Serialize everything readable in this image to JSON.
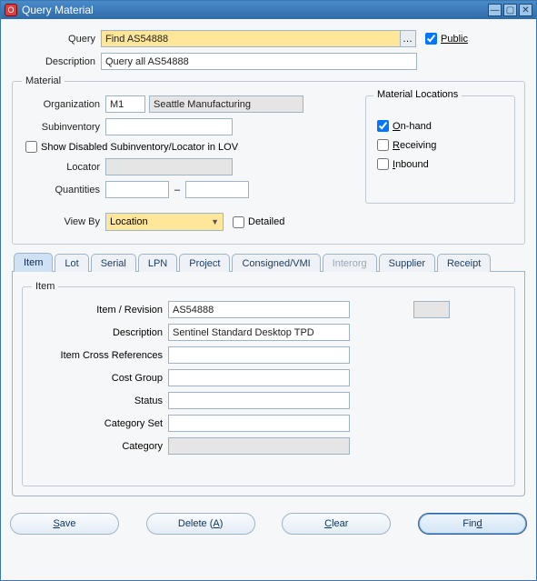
{
  "window": {
    "title": "Query Material"
  },
  "top": {
    "query_label": "Query",
    "query_value": "Find AS54888",
    "public_label": "Public",
    "public_checked": true,
    "description_label": "Description",
    "description_value": "Query all AS54888"
  },
  "material": {
    "legend": "Material",
    "organization_label": "Organization",
    "organization_code": "M1",
    "organization_name": "Seattle Manufacturing",
    "subinventory_label": "Subinventory",
    "subinventory_value": "",
    "show_disabled_label": "Show Disabled Subinventory/Locator in LOV",
    "show_disabled_checked": false,
    "locator_label": "Locator",
    "locator_value": "",
    "quantities_label": "Quantities",
    "quantity_from": "",
    "quantity_to": "",
    "locations": {
      "title": "Material Locations",
      "onhand_label": "On-hand",
      "onhand_checked": true,
      "receiving_label": "Receiving",
      "receiving_checked": false,
      "inbound_label": "Inbound",
      "inbound_checked": false
    }
  },
  "viewby": {
    "label": "View By",
    "value": "Location",
    "detailed_label": "Detailed",
    "detailed_checked": false
  },
  "tabs": {
    "names": [
      "Item",
      "Lot",
      "Serial",
      "LPN",
      "Project",
      "Consigned/VMI",
      "Interorg",
      "Supplier",
      "Receipt"
    ],
    "active_index": 0,
    "disabled_indexes": [
      6
    ]
  },
  "item": {
    "legend": "Item",
    "item_revision_label": "Item / Revision",
    "item_value": "AS54888",
    "description_label": "Description",
    "description_value": "Sentinel Standard Desktop TPD",
    "cross_ref_label": "Item Cross References",
    "cross_ref_value": "",
    "cost_group_label": "Cost Group",
    "cost_group_value": "",
    "status_label": "Status",
    "status_value": "",
    "category_set_label": "Category Set",
    "category_set_value": "",
    "category_label": "Category",
    "category_value": ""
  },
  "buttons": {
    "save": "Save",
    "delete": "Delete (A)",
    "clear": "Clear",
    "find": "Find"
  }
}
